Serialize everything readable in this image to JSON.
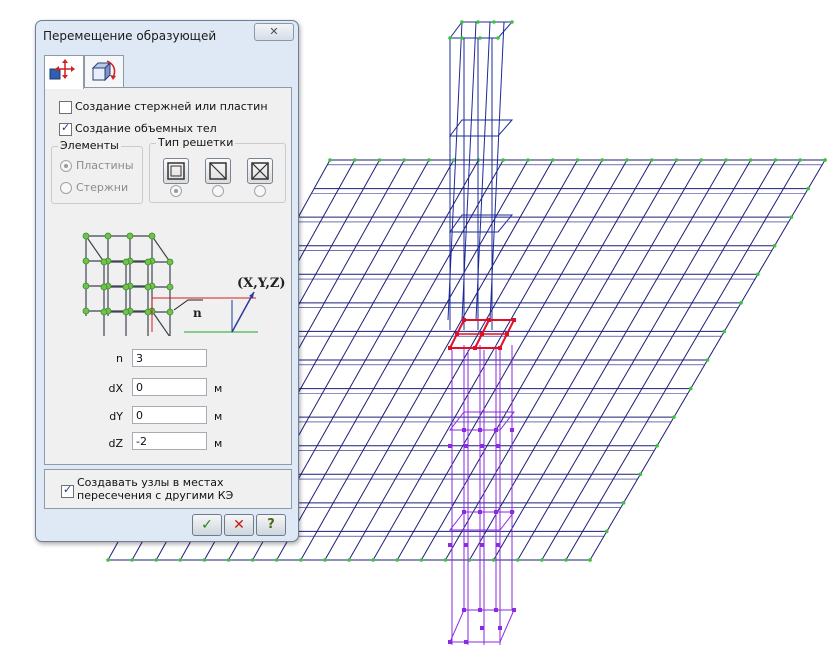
{
  "dialog": {
    "title": "Перемещение образующей",
    "close_label": "✕",
    "tabs": [
      {
        "name": "move-tab",
        "icon": "move-element-icon",
        "active": true
      },
      {
        "name": "rotate-tab",
        "icon": "rotate-element-icon",
        "active": false
      }
    ],
    "create_rods_label": "Создание стержней или пластин",
    "create_rods_checked": false,
    "create_solids_label": "Создание объемных тел",
    "create_solids_checked": true,
    "elements_group": {
      "title": "Элементы",
      "options": [
        "Пластины",
        "Стержни"
      ],
      "selected": 0
    },
    "lattice_group": {
      "title": "Тип решетки",
      "options": [
        "square-lattice-icon",
        "diagonal-lattice-icon",
        "cross-lattice-icon"
      ],
      "selected": 0
    },
    "illustration": {
      "axis_label": "(X,Y,Z)",
      "n_label": "n"
    },
    "fields": [
      {
        "label": "n",
        "value": "3",
        "unit": ""
      },
      {
        "label": "dX",
        "value": "0",
        "unit": "м"
      },
      {
        "label": "dY",
        "value": "0",
        "unit": "м"
      },
      {
        "label": "dZ",
        "value": "-2",
        "unit": "м"
      }
    ],
    "intersect_label_line1": "Создавать узлы в местах",
    "intersect_label_line2": "пересечения с другими КЭ",
    "intersect_checked": true,
    "buttons": {
      "ok": "✓",
      "cancel": "✕",
      "help": "?"
    }
  },
  "colors": {
    "mesh": "#1e1e7a",
    "node": "#38c638",
    "column_top": "#1d2a9a",
    "column_bottom": "#8a2be2",
    "selected": "#e0102a",
    "dialog_bg": "#dfe9f5"
  }
}
